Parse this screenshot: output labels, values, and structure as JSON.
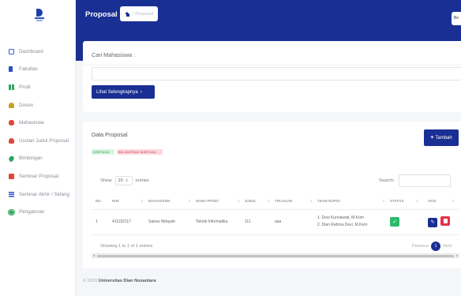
{
  "sidebar": {
    "items": [
      {
        "label": "Dashboard",
        "icon": "dashboard-icon"
      },
      {
        "label": "Fakultas",
        "icon": "building-icon"
      },
      {
        "label": "Prodi",
        "icon": "grid-icon"
      },
      {
        "label": "Dosen",
        "icon": "user-icon"
      },
      {
        "label": "Mahasiswa",
        "icon": "users-icon"
      },
      {
        "label": "Usulan Judul Proposal",
        "icon": "lightbulb-icon"
      },
      {
        "label": "Bimbingan",
        "icon": "pin-icon"
      },
      {
        "label": "Seminar Proposal",
        "icon": "book-icon"
      },
      {
        "label": "Seminar Akhir / Sidang",
        "icon": "list-icon"
      },
      {
        "label": "Pengaturan",
        "icon": "gear-icon"
      }
    ]
  },
  "header": {
    "title": "Proposal",
    "breadcrumb": "/ Proposal",
    "right_button": "Bo"
  },
  "search_card": {
    "title": "Cari Mahasiswa :",
    "input_value": "",
    "more_button": "Lihat Selengkapnya",
    "more_chevron": "›"
  },
  "data_card": {
    "title": "Data Proposal",
    "add_button": "Tambah",
    "badges": {
      "approved": "DISETUJUI",
      "rejected": "BELUM/TIDAK DISETUJUI"
    },
    "show_label": "Show",
    "entries_value": "10",
    "entries_label": "entries",
    "search_label": "Search:",
    "columns": [
      "NO",
      "NIM",
      "MAHASISWA",
      "NAMA PRODI",
      "JUDUL",
      "TINJAUAN",
      "TEAM NOPIG",
      "STATUS",
      "AKSI"
    ],
    "rows": [
      {
        "no": "1",
        "nim": "411192117",
        "mahasiswa": "Saesa Hidayah",
        "prodi": "Teknik Informatika",
        "judul": "111",
        "tinjauan": "aaa",
        "dosen_1": "1. Desi Kurniawati, M.Kom",
        "dosen_2": "2. Dian Rahma Devi, M.Kom",
        "status_color": "#2bb96a"
      }
    ],
    "showing_text": "Showing 1 to 1 of 1 entries",
    "pagination": {
      "previous": "Previous",
      "current": "1",
      "next": "Next"
    }
  },
  "footer": {
    "prefix": "© 2023",
    "org": "Universitas Dian Nusantara"
  }
}
